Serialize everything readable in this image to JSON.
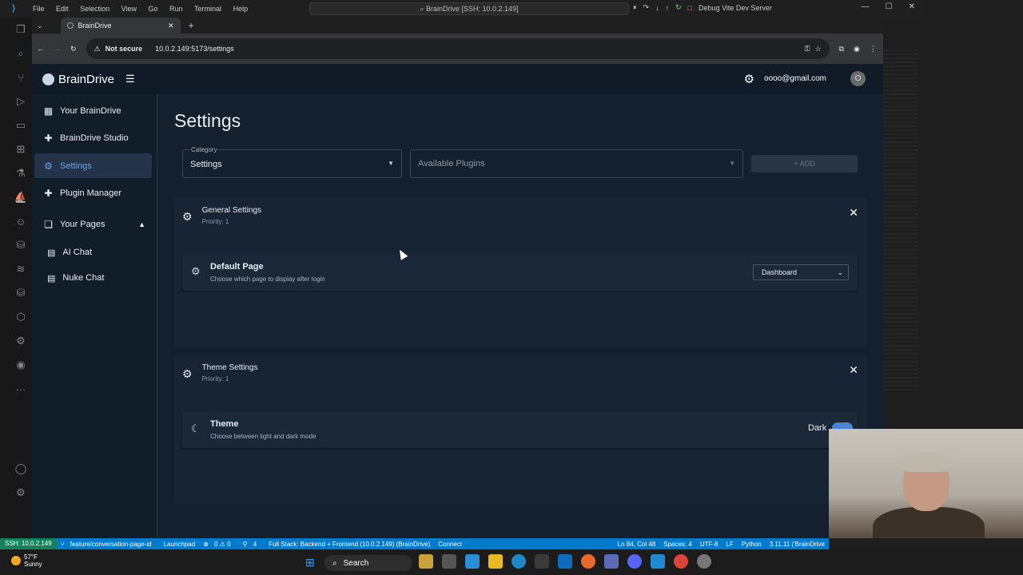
{
  "vscode": {
    "menu": [
      "File",
      "Edit",
      "Selection",
      "View",
      "Go",
      "Run",
      "Terminal",
      "Help"
    ],
    "search_title": "BrainDrive [SSH: 10.0.2.149]",
    "debug_config": "Debug Vite Dev Server"
  },
  "browser": {
    "tab_title": "BrainDrive",
    "security_label": "Not secure",
    "url": "10.0.2.149:5173/settings"
  },
  "app": {
    "brand": "BrainDrive",
    "user_email": "oooo@gmail.com",
    "avatar_initial": "O",
    "sidebar": {
      "items": [
        {
          "label": "Your BrainDrive",
          "icon": "dashboard-icon"
        },
        {
          "label": "BrainDrive Studio",
          "icon": "puzzle-icon"
        },
        {
          "label": "Settings",
          "icon": "gear-icon"
        },
        {
          "label": "Plugin Manager",
          "icon": "puzzle-icon"
        }
      ],
      "pages_group": "Your Pages",
      "pages": [
        "AI Chat",
        "Nuke Chat"
      ]
    },
    "page_title": "Settings",
    "category": {
      "label": "Category",
      "value": "Settings"
    },
    "plugins_placeholder": "Available Plugins",
    "add_label": "ADD",
    "sections": [
      {
        "title": "General Settings",
        "priority": "Priority: 1",
        "setting": {
          "title": "Default Page",
          "description": "Choose which page to display after login",
          "value": "Dashboard"
        }
      },
      {
        "title": "Theme Settings",
        "priority": "Priority: 1",
        "setting": {
          "title": "Theme",
          "description": "Choose between light and dark mode",
          "value": "Dark"
        }
      }
    ]
  },
  "statusbar": {
    "remote": "SSH: 10.0.2.149",
    "branch": "feature/conversation-page-id",
    "launchpad": "Launchpad",
    "problems": "0 ⚠ 0",
    "ports": "4",
    "task": "Full Stack: Backend + Frontend (10.0.2.149) (BrainDrive)",
    "connect": "Connect",
    "position": "Ln 84, Col 48",
    "spaces": "Spaces: 4",
    "encoding": "UTF-8",
    "eol": "LF",
    "language": "Python",
    "interpreter": "3.11.11 ('BrainDrive"
  },
  "taskbar": {
    "temperature": "57°F",
    "weather": "Sunny",
    "search_label": "Search"
  },
  "colors": {
    "accent": "#6ea4e8",
    "app_bg": "#14202e",
    "status_blue": "#007acc"
  }
}
